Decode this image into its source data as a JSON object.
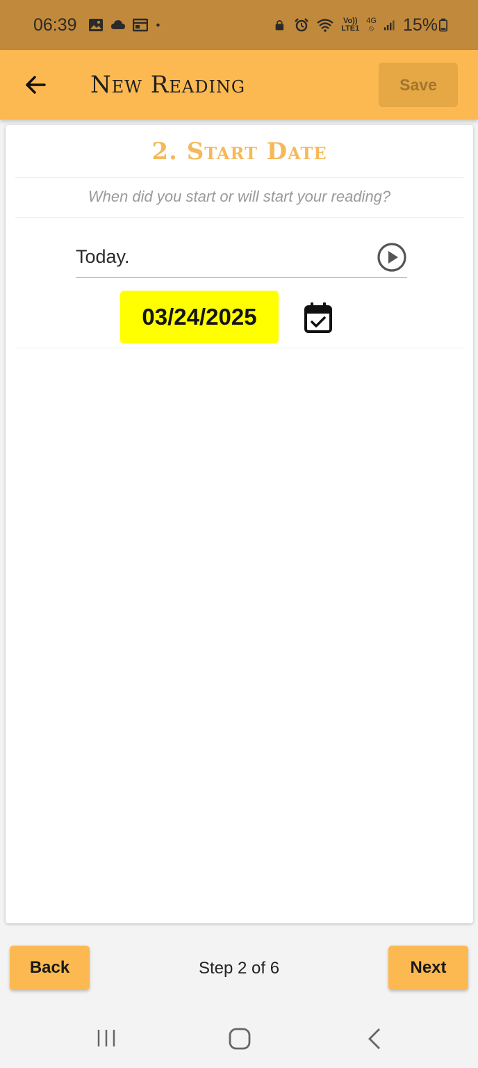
{
  "status_bar": {
    "time": "06:39",
    "battery_percent": "15%",
    "network_volte": "Vo))",
    "network_lte": "LTE1",
    "network_4g": "4G",
    "icons": [
      "gallery-icon",
      "cloud-icon",
      "calendar-notification-icon",
      "dot-icon",
      "lock-icon",
      "alarm-icon",
      "wifi-icon",
      "signal-icon",
      "battery-icon"
    ]
  },
  "app_bar": {
    "title": "New Reading",
    "save_label": "Save"
  },
  "step": {
    "title": "2. Start Date",
    "subtitle": "When did you start or will start your reading?",
    "today_label": "Today.",
    "date_value": "03/24/2025"
  },
  "footer": {
    "back_label": "Back",
    "step_indicator": "Step 2 of 6",
    "next_label": "Next"
  },
  "colors": {
    "status_bar": "#c1893b",
    "accent": "#fdb951",
    "title_accent": "#f5b95a",
    "date_highlight": "#ffff00"
  }
}
